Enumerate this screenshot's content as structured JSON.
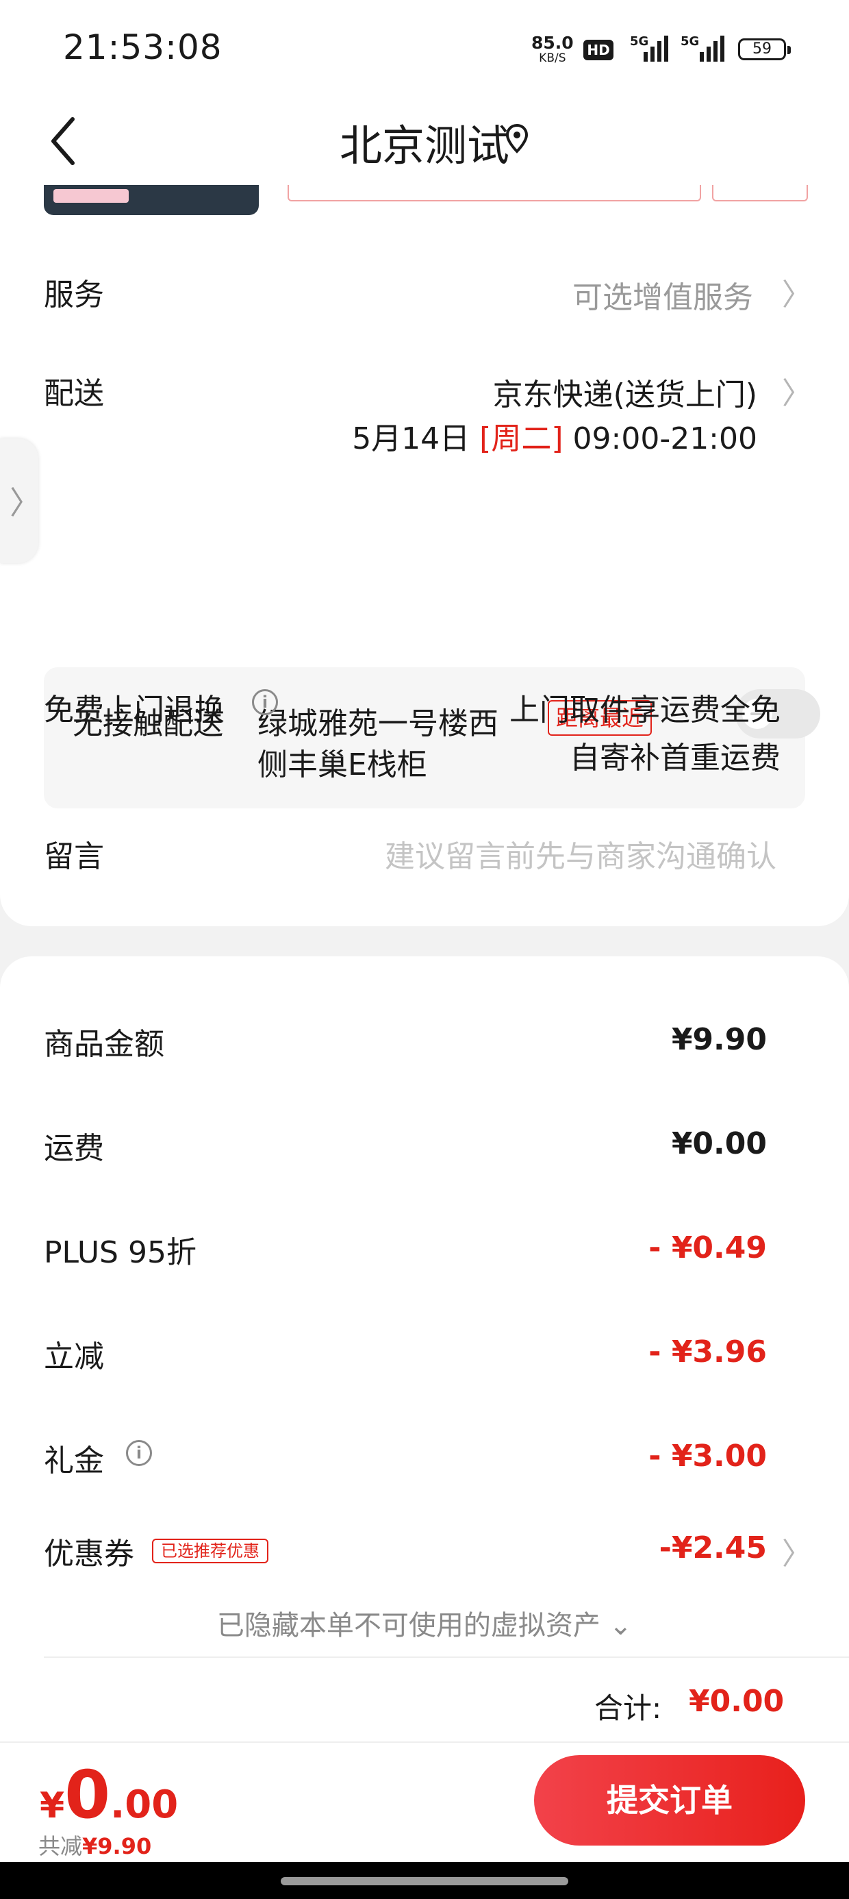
{
  "status_bar": {
    "time": "21:53:08",
    "net_speed": "85.0",
    "net_unit": "KB/S",
    "hd_label": "HD",
    "sim1": "5G",
    "sim2": "5G",
    "battery": "59"
  },
  "header": {
    "title": "北京测试"
  },
  "service": {
    "label": "服务",
    "value": "可选增值服务"
  },
  "delivery": {
    "label": "配送",
    "method": "京东快递(送货上门)",
    "date": "5月14日",
    "weekday": "[周二]",
    "time_range": "09:00-21:00"
  },
  "contactless": {
    "label": "无接触配送",
    "address_line1": "绿城雅苑一号楼西",
    "address_line2": "侧丰巢E栈柜",
    "tag": "距离最近"
  },
  "free_return": {
    "label": "免费上门退换",
    "line1": "上门取件享运费全免",
    "line2": "自寄补首重运费"
  },
  "message": {
    "label": "留言",
    "placeholder": "建议留言前先与商家沟通确认"
  },
  "summary": {
    "items": [
      {
        "label": "商品金额",
        "value": "¥9.90"
      },
      {
        "label": "运费",
        "value": "¥0.00"
      },
      {
        "label": "PLUS 95折",
        "value": "- ¥0.49"
      },
      {
        "label": "立减",
        "value": "- ¥3.96"
      },
      {
        "label": "礼金",
        "value": "- ¥3.00"
      },
      {
        "label": "优惠券",
        "value": "-¥2.45"
      }
    ],
    "coupon_tag": "已选推荐优惠",
    "hidden_note": "已隐藏本单不可使用的虚拟资产",
    "total_label": "合计:",
    "total_value": "¥0.00"
  },
  "bottom": {
    "currency": "¥",
    "int_part": "0",
    "dec_part": ".00",
    "saved_label": "共减",
    "saved_value": "¥9.90",
    "submit_label": "提交订单"
  },
  "colors": {
    "accent": "#e2231a",
    "background": "#f2f2f2"
  }
}
